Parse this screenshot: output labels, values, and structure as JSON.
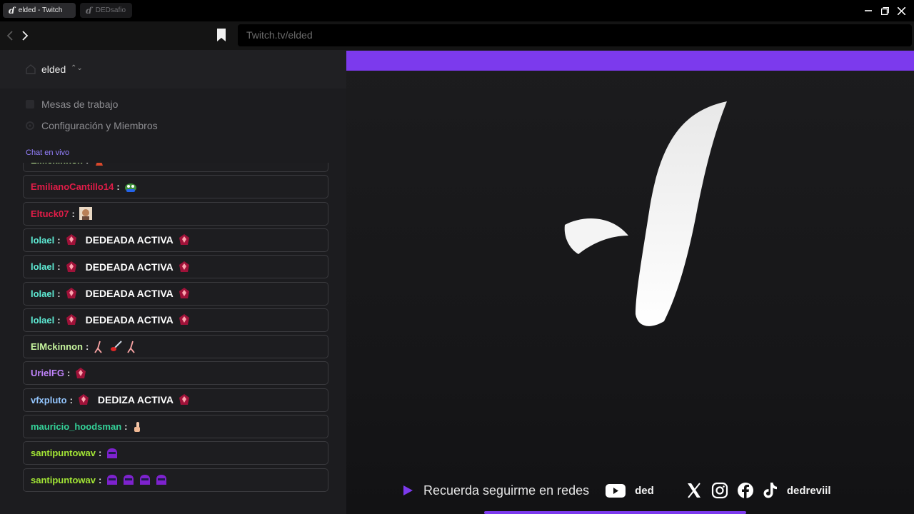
{
  "tabs": [
    {
      "label": "elded - Twitch",
      "icon": "twitch-d-logo-icon"
    },
    {
      "label": "DEDsafio",
      "icon": "twitch-d-logo-icon"
    }
  ],
  "window_controls": [
    "minimize-icon",
    "restore-icon",
    "close-icon"
  ],
  "nav": {
    "url": "Twitch.tv/elded"
  },
  "sidebar": {
    "workspace": "elded",
    "items": [
      {
        "label": "Mesas de trabajo",
        "icon": "table-icon"
      },
      {
        "label": "Configuración y Miembros",
        "icon": "settings-icon"
      }
    ],
    "chat_title": "Chat en vivo"
  },
  "chat": [
    {
      "user": "ElMckinnon",
      "color": "#c7f59e",
      "text": "",
      "emotes": [
        "cone"
      ]
    },
    {
      "user": "EmilianoCantillo14",
      "color": "#e11d48",
      "text": "",
      "emotes": [
        "pepe"
      ]
    },
    {
      "user": "Eltuck07",
      "color": "#e11d48",
      "text": "",
      "emotes": [
        "face"
      ]
    },
    {
      "user": "lolael",
      "color": "#5eead4",
      "text": "DEDEADA ACTIVA",
      "emotes": [
        "gem",
        "gem"
      ]
    },
    {
      "user": "lolael",
      "color": "#5eead4",
      "text": "DEDEADA ACTIVA",
      "emotes": [
        "gem",
        "gem"
      ]
    },
    {
      "user": "lolael",
      "color": "#5eead4",
      "text": "DEDEADA ACTIVA",
      "emotes": [
        "gem",
        "gem"
      ]
    },
    {
      "user": "lolael",
      "color": "#5eead4",
      "text": "DEDEADA ACTIVA",
      "emotes": [
        "gem",
        "gem"
      ]
    },
    {
      "user": "ElMckinnon",
      "color": "#c7f59e",
      "text": "",
      "emotes": [
        "stick",
        "guitar",
        "stick"
      ]
    },
    {
      "user": "UrielFG",
      "color": "#c084fc",
      "text": "",
      "emotes": [
        "gem"
      ]
    },
    {
      "user": "vfxpluto",
      "color": "#93c5fd",
      "text": "DEDIZA ACTIVA",
      "emotes": [
        "gem",
        "gem"
      ]
    },
    {
      "user": "mauricio_hoodsman",
      "color": "#34d399",
      "text": "",
      "emotes": [
        "finger"
      ]
    },
    {
      "user": "santipuntowav",
      "color": "#a3e635",
      "text": "",
      "emotes": [
        "ghost"
      ]
    },
    {
      "user": "santipuntowav",
      "color": "#a3e635",
      "text": "",
      "emotes": [
        "ghost",
        "ghost",
        "ghost",
        "ghost"
      ]
    }
  ],
  "stream": {
    "accent": "#7c3aed",
    "footer_text": "Recuerda seguirme en redes",
    "youtube_handle": "ded",
    "social_icons": [
      "youtube-icon",
      "x-icon",
      "instagram-icon",
      "facebook-icon",
      "tiktok-icon"
    ],
    "tiktok_handle": "dedreviil"
  }
}
